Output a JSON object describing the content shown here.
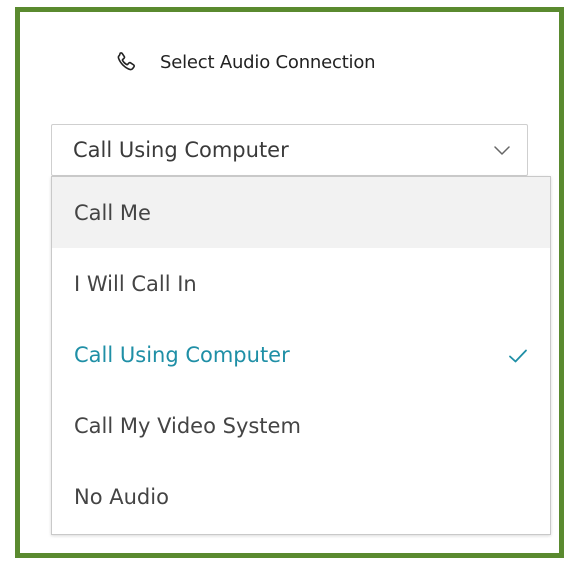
{
  "header": {
    "icon": "phone-icon",
    "title": "Select Audio Connection"
  },
  "select": {
    "value": "Call Using Computer",
    "icon": "chevron-down-icon"
  },
  "dropdown": {
    "options": [
      {
        "label": "Call Me",
        "state": "hovered"
      },
      {
        "label": "I Will Call In",
        "state": ""
      },
      {
        "label": "Call Using Computer",
        "state": "selected"
      },
      {
        "label": "Call My Video System",
        "state": ""
      },
      {
        "label": "No Audio",
        "state": ""
      }
    ],
    "selected_icon": "checkmark-icon"
  },
  "colors": {
    "frame_border": "#5a8a2f",
    "selected_text": "#1f8fa6",
    "hover_bg": "#f2f2f2"
  }
}
